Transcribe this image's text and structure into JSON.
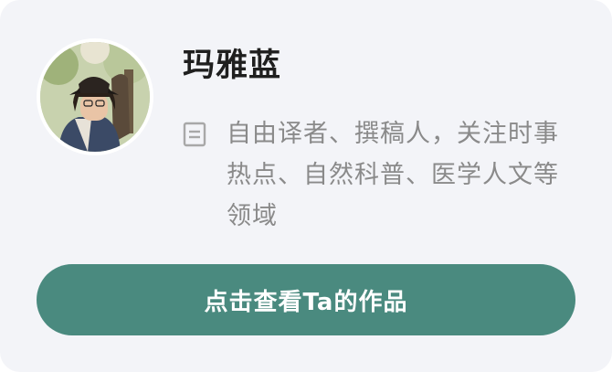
{
  "profile": {
    "name": "玛雅蓝",
    "avatar_icon": "author-avatar-photo",
    "bio_icon": "document-icon",
    "bio": "自由译者、撰稿人，关注时事热点、自然科普、医学人文等领域"
  },
  "cta": {
    "label": "点击查看Ta的作品",
    "color": "#4a8a7f"
  },
  "colors": {
    "card_background": "#f3f4f8",
    "name_text": "#1f1f1f",
    "bio_text": "#8a8a8a",
    "icon": "#a8a8a8"
  }
}
